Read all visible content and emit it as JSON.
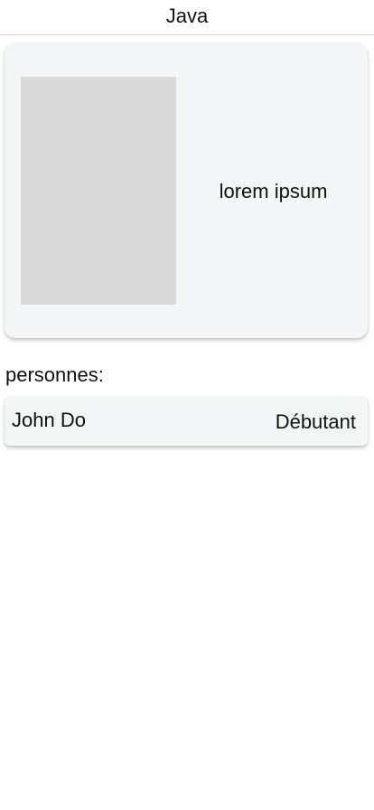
{
  "header": {
    "title": "Java"
  },
  "hero": {
    "image_alt": "placeholder-image",
    "text": "lorem ipsum"
  },
  "people": {
    "label": "personnes:",
    "items": [
      {
        "name": "John Do",
        "level": "Débutant"
      }
    ]
  }
}
